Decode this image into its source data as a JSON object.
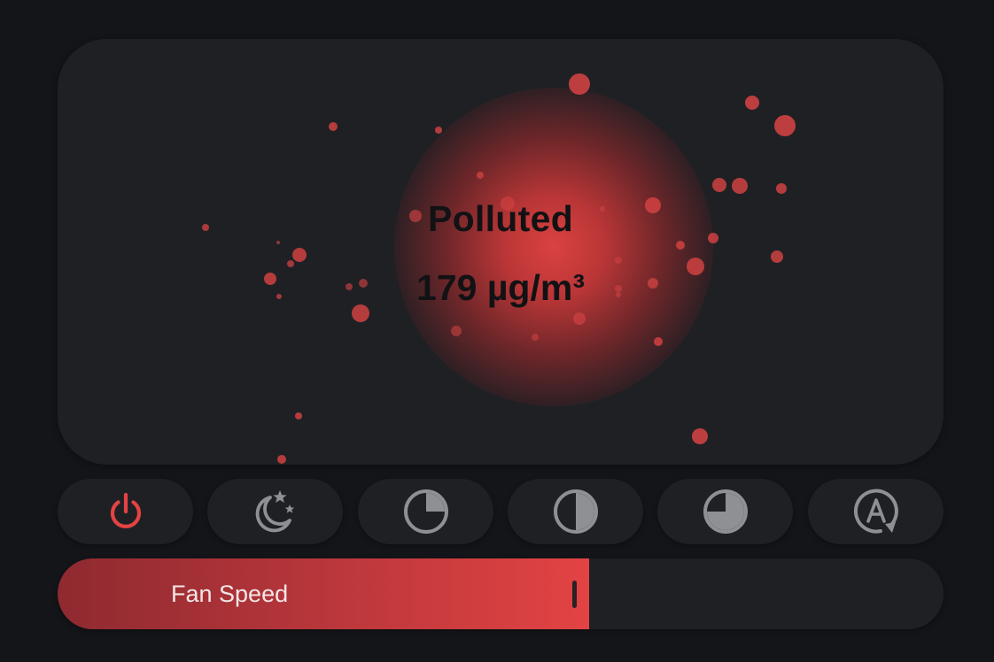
{
  "air_quality": {
    "status": "Polluted",
    "value_text": "179 µg/m³"
  },
  "modes": [
    {
      "id": "power",
      "icon": "power-icon",
      "active": true
    },
    {
      "id": "night",
      "icon": "moon-stars-icon",
      "active": false
    },
    {
      "id": "low",
      "icon": "quarter-circle-icon",
      "active": false
    },
    {
      "id": "medium",
      "icon": "half-circle-icon",
      "active": false
    },
    {
      "id": "high",
      "icon": "three-quarter-circle-icon",
      "active": false
    },
    {
      "id": "auto",
      "icon": "auto-mode-icon",
      "active": false
    }
  ],
  "fan_speed": {
    "label": "Fan Speed",
    "level_fraction": 0.6
  },
  "colors": {
    "accent": "#e34343",
    "icon_inactive": "#8f9094",
    "card": "#1f2024",
    "background": "#141519"
  }
}
